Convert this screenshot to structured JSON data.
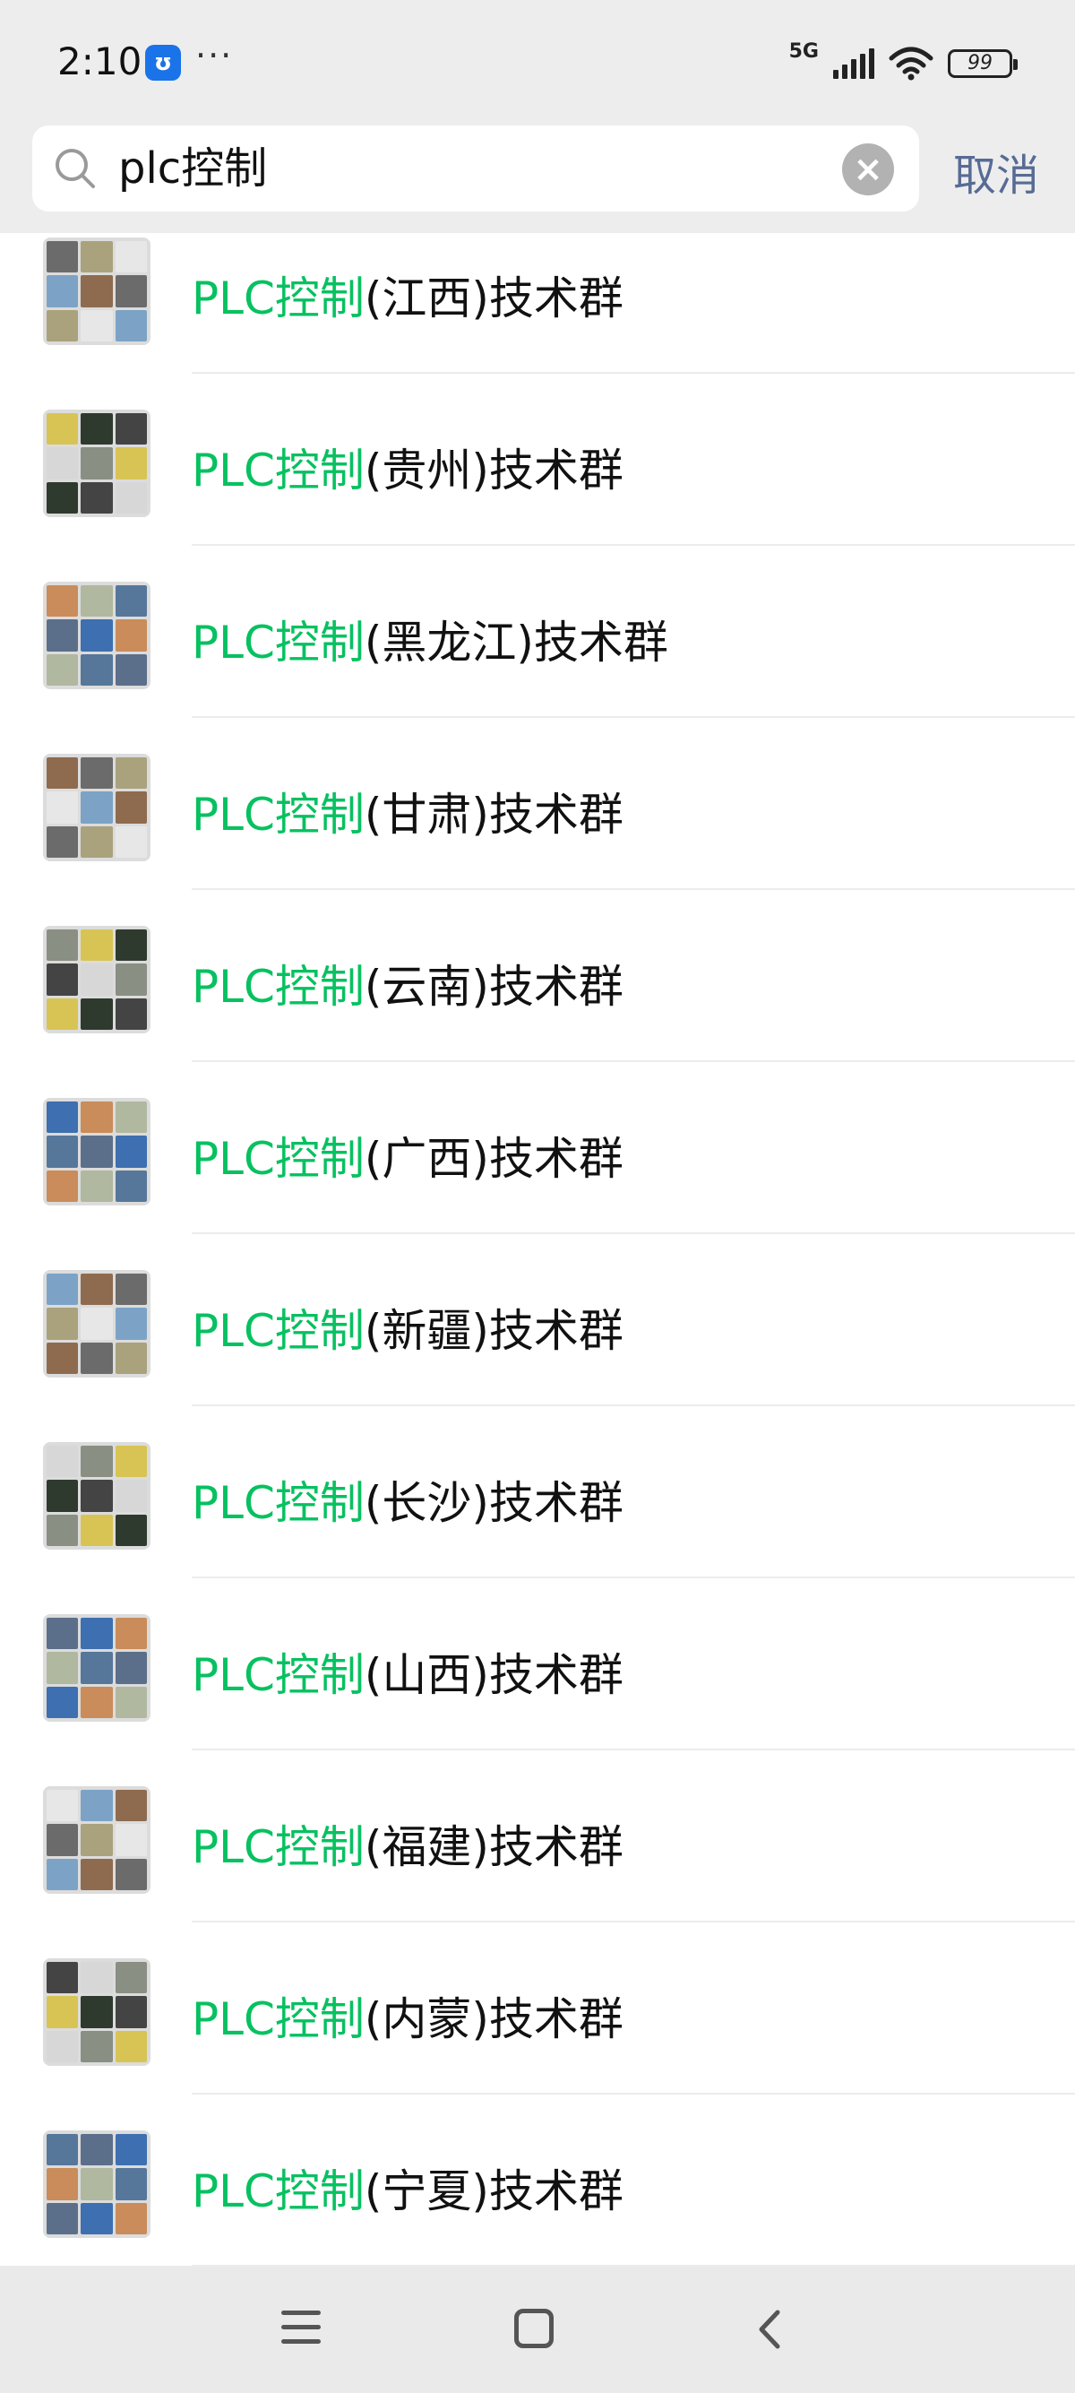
{
  "status_bar": {
    "time": "2:10",
    "app_badge": "ʊ",
    "more": "···",
    "network": "5G",
    "battery": "99"
  },
  "search": {
    "query": "plc控制",
    "placeholder": "",
    "cancel_label": "取消"
  },
  "results": [
    {
      "highlight": "PLC控制",
      "rest": "(江西)技术群"
    },
    {
      "highlight": "PLC控制",
      "rest": "(贵州)技术群"
    },
    {
      "highlight": "PLC控制",
      "rest": "(黑龙江)技术群"
    },
    {
      "highlight": "PLC控制",
      "rest": "(甘肃)技术群"
    },
    {
      "highlight": "PLC控制",
      "rest": "(云南)技术群"
    },
    {
      "highlight": "PLC控制",
      "rest": "(广西)技术群"
    },
    {
      "highlight": "PLC控制",
      "rest": "(新疆)技术群"
    },
    {
      "highlight": "PLC控制",
      "rest": "(长沙)技术群"
    },
    {
      "highlight": "PLC控制",
      "rest": "(山西)技术群"
    },
    {
      "highlight": "PLC控制",
      "rest": "(福建)技术群"
    },
    {
      "highlight": "PLC控制",
      "rest": "(内蒙)技术群"
    },
    {
      "highlight": "PLC控制",
      "rest": "(宁夏)技术群"
    },
    {
      "highlight": "",
      "rest": ""
    }
  ],
  "colors": {
    "highlight": "#07c160",
    "cancel": "#576b95",
    "header_bg": "#ededed"
  },
  "icons": [
    "search-icon",
    "clear-icon",
    "menu-icon",
    "home-icon",
    "back-icon",
    "signal-icon",
    "wifi-icon",
    "battery-icon"
  ]
}
